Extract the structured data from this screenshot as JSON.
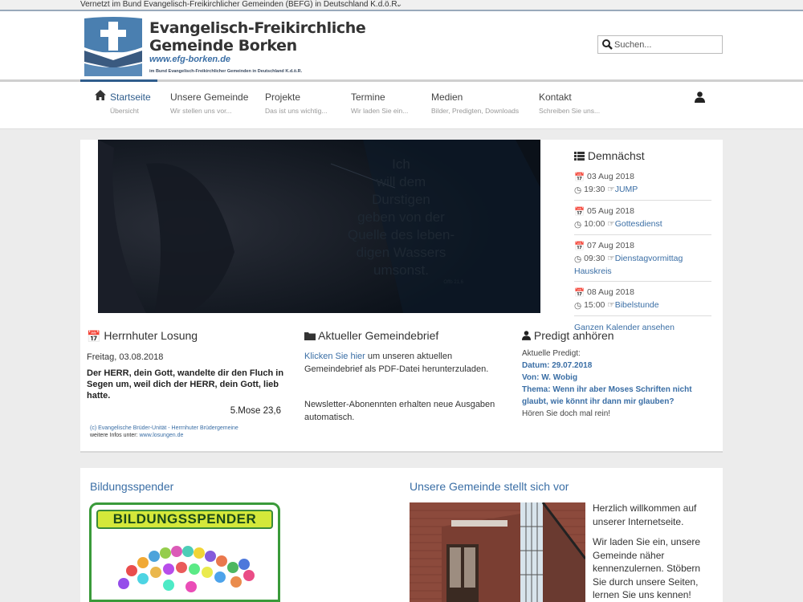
{
  "topbar": {
    "text": "Vernetzt im Bund Evangelisch-Freikirchlicher Gemeinden (BEFG) in Deutschland K.d.ö.R."
  },
  "header": {
    "title_line1": "Evangelisch-Freikirchliche",
    "title_line2": "Gemeinde Borken",
    "url": "www.efg-borken.de",
    "subline": "im Bund Evangelisch-Freikirchlicher Gemeinden in Deutschland K.d.ö.R."
  },
  "search": {
    "placeholder": "Suchen..."
  },
  "nav": [
    {
      "label": "Startseite",
      "sub": "Übersicht"
    },
    {
      "label": "Unsere Gemeinde",
      "sub": "Wir stellen uns vor..."
    },
    {
      "label": "Projekte",
      "sub": "Das ist uns wichtig..."
    },
    {
      "label": "Termine",
      "sub": "Wir laden Sie ein..."
    },
    {
      "label": "Medien",
      "sub": "Bilder, Predigten, Downloads"
    },
    {
      "label": "Kontakt",
      "sub": "Schreiben Sie uns..."
    }
  ],
  "hero": {
    "lines": [
      "Ich",
      "will dem",
      "Durstigen",
      "geben von der",
      "Quelle des leben-",
      "digen Wassers",
      "umsonst."
    ],
    "ref": "Offb 21,6"
  },
  "events": {
    "title": "Demnächst",
    "items": [
      {
        "date": "03 Aug 2018",
        "time": "19:30",
        "name": "JUMP"
      },
      {
        "date": "05 Aug 2018",
        "time": "10:00",
        "name": "Gottesdienst"
      },
      {
        "date": "07 Aug 2018",
        "time": "09:30",
        "name": "Dienstagvormittag",
        "name2": "Hauskreis"
      },
      {
        "date": "08 Aug 2018",
        "time": "15:00",
        "name": "Bibelstunde"
      }
    ],
    "all": "Ganzen Kalender ansehen"
  },
  "losung": {
    "title": "Herrnhuter Losung",
    "date": "Freitag, 03.08.2018",
    "text": "Der HERR, dein Gott, wandelte dir den Fluch in Segen um, weil dich der HERR, dein Gott, lieb hatte.",
    "ref": "5.Mose 23,6",
    "credit": "(c) Evangelische Brüder-Unität - Herrnhuter Brüdergemeine",
    "more_label": "weitere Infos unter:",
    "more_link": "www.losungen.de"
  },
  "gemeindebrief": {
    "title": "Aktueller Gemeindebrief",
    "link": "Klicken Sie hier",
    "text": " um unseren aktuellen Gemeindebrief als PDF-Datei herunterzuladen.",
    "newsletter": "Newsletter-Abonennten erhalten neue Ausgaben automatisch."
  },
  "predigt": {
    "title": "Predigt anhören",
    "current": "Aktuelle Predigt:",
    "date": "Datum: 29.07.2018",
    "by": "Von: W. Wobig",
    "topic": "Thema: Wenn ihr aber Moses Schriften nicht glaubt, wie könnt ihr dann mir glauben?",
    "listen": "Hören Sie doch mal rein!"
  },
  "bildung": {
    "title": "Bildungsspender",
    "badge": "BILDUNGSSPENDER"
  },
  "intro": {
    "title": "Unsere Gemeinde stellt sich vor",
    "p1": "Herzlich willkommen auf unserer Internetseite.",
    "p2": "Wir laden Sie ein, unsere Gemeinde näher kennenzulernen. Stöbern Sie durch unsere Seiten, lernen Sie uns kennen! Wenn Sie"
  },
  "colors": {
    "accent": "#3a6ea5",
    "nav_active": "#2f5d8c",
    "badge_green": "#3a9a3a",
    "badge_yellow": "#d4e83a"
  }
}
